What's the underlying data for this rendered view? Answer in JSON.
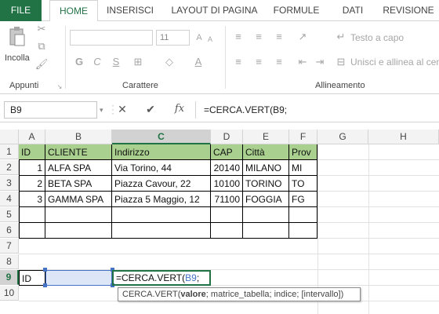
{
  "tabs": [
    "FILE",
    "HOME",
    "INSERISCI",
    "LAYOUT DI PAGINA",
    "FORMULE",
    "DATI",
    "REVISIONE"
  ],
  "ribbon": {
    "paste_label": "Incolla",
    "clipboard_group": "Appunti",
    "font_group": "Carattere",
    "font_size": "11",
    "bold": "G",
    "italic": "C",
    "underline": "S",
    "alignment_group": "Allineamento",
    "wrap_text": "Testo a capo",
    "merge_center": "Unisci e allinea al centro"
  },
  "formula_bar": {
    "name_box": "B9",
    "cancel": "✕",
    "enter": "✔",
    "fx": "fx",
    "formula": "=CERCA.VERT(B9;"
  },
  "columns": [
    "A",
    "B",
    "C",
    "D",
    "E",
    "F",
    "G",
    "H"
  ],
  "rows": [
    "1",
    "2",
    "3",
    "4",
    "5",
    "6",
    "7",
    "8",
    "9",
    "10"
  ],
  "table": {
    "headers": [
      "ID",
      "CLIENTE",
      "Indirizzo",
      "CAP",
      "Città",
      "Prov"
    ],
    "rows": [
      [
        "1",
        "ALFA SPA",
        "Via Torino, 44",
        "20140",
        "MILANO",
        "MI"
      ],
      [
        "2",
        "BETA SPA",
        "Piazza Cavour, 22",
        "10100",
        "TORINO",
        "TO"
      ],
      [
        "3",
        "GAMMA SPA",
        "Piazza 5 Maggio, 12",
        "71100",
        "FOGGIA",
        "FG"
      ]
    ]
  },
  "row9": {
    "a": "ID",
    "formula_prefix": "=CERCA.VERT(",
    "formula_ref": "B9",
    "formula_suffix": ";"
  },
  "tooltip": {
    "fn": "CERCA.VERT(",
    "arg1": "valore",
    "rest": "; matrice_tabella; indice; [intervallo])"
  },
  "colors": {
    "accent": "#217346",
    "header_fill": "#a9d08e",
    "ref_blue": "#4472c4",
    "selected_fill": "#dde6f6"
  }
}
